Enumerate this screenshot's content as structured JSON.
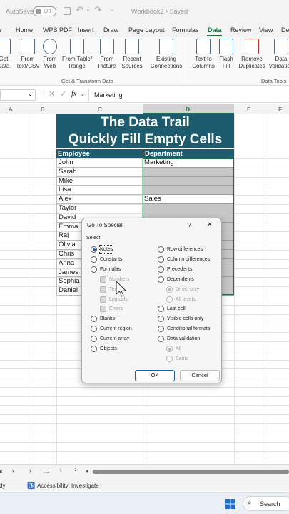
{
  "titlebar": {
    "autosave": "AutoSave",
    "autosave_state": "Off",
    "workbook": "Workbook2 • Saved"
  },
  "tabs": [
    "e",
    "Home",
    "WPS PDF",
    "Insert",
    "Draw",
    "Page Layout",
    "Formulas",
    "Data",
    "Review",
    "View",
    "De"
  ],
  "ribbon": {
    "buttons": [
      "Get Data",
      "From Text/CSV",
      "From Web",
      "From Table/ Range",
      "From Picture",
      "Recent Sources",
      "Existing Connections",
      "Text to Columns",
      "Flash Fill",
      "Remove Duplicates",
      "Data Validation"
    ],
    "group1": "Get & Transform Data",
    "group2": "Data Tools"
  },
  "formula": {
    "fx": "fx",
    "value": "Marketing"
  },
  "columns": [
    "A",
    "B",
    "C",
    "D",
    "E",
    "F"
  ],
  "sheet": {
    "title1": "The Data Trail",
    "title2": "Quickly Fill Empty Cells",
    "hdr_emp": "Employee",
    "hdr_dept": "Department",
    "employees": [
      "John",
      "Sarah",
      "Mike",
      "Lisa",
      "Alex",
      "Taylor",
      "David",
      "Emma",
      "Raj",
      "Olivia",
      "Chris",
      "Anna",
      "James",
      "Sophia",
      "Daniel"
    ],
    "departments": [
      "Marketing",
      "",
      "",
      "",
      "Sales",
      "",
      "",
      "",
      "",
      "",
      "",
      "",
      "",
      "",
      ""
    ]
  },
  "dialog": {
    "title": "Go To Special",
    "help": "?",
    "close": "✕",
    "section": "Select",
    "left": [
      "Notes",
      "Constants",
      "Formulas",
      "Numbers",
      "Text",
      "Logicals",
      "Errors",
      "Blanks",
      "Current region",
      "Current array",
      "Objects"
    ],
    "right": [
      "Row differences",
      "Column differences",
      "Precedents",
      "Dependents",
      "Direct only",
      "All levels",
      "Last cell",
      "Visible cells only",
      "Conditional formats",
      "Data validation",
      "All",
      "Same"
    ],
    "ok": "OK",
    "cancel": "Cancel"
  },
  "sheetbar": {
    "dots": "...",
    "plus": "+"
  },
  "status": {
    "ready": "dy",
    "accessibility": "Accessibility: Investigate"
  },
  "taskbar": {
    "search": "Search"
  },
  "colors": {
    "teal": "#1d5c6e",
    "green": "#1e7145",
    "selection": "#c6c6c6",
    "accent": "#1a5fb4"
  }
}
